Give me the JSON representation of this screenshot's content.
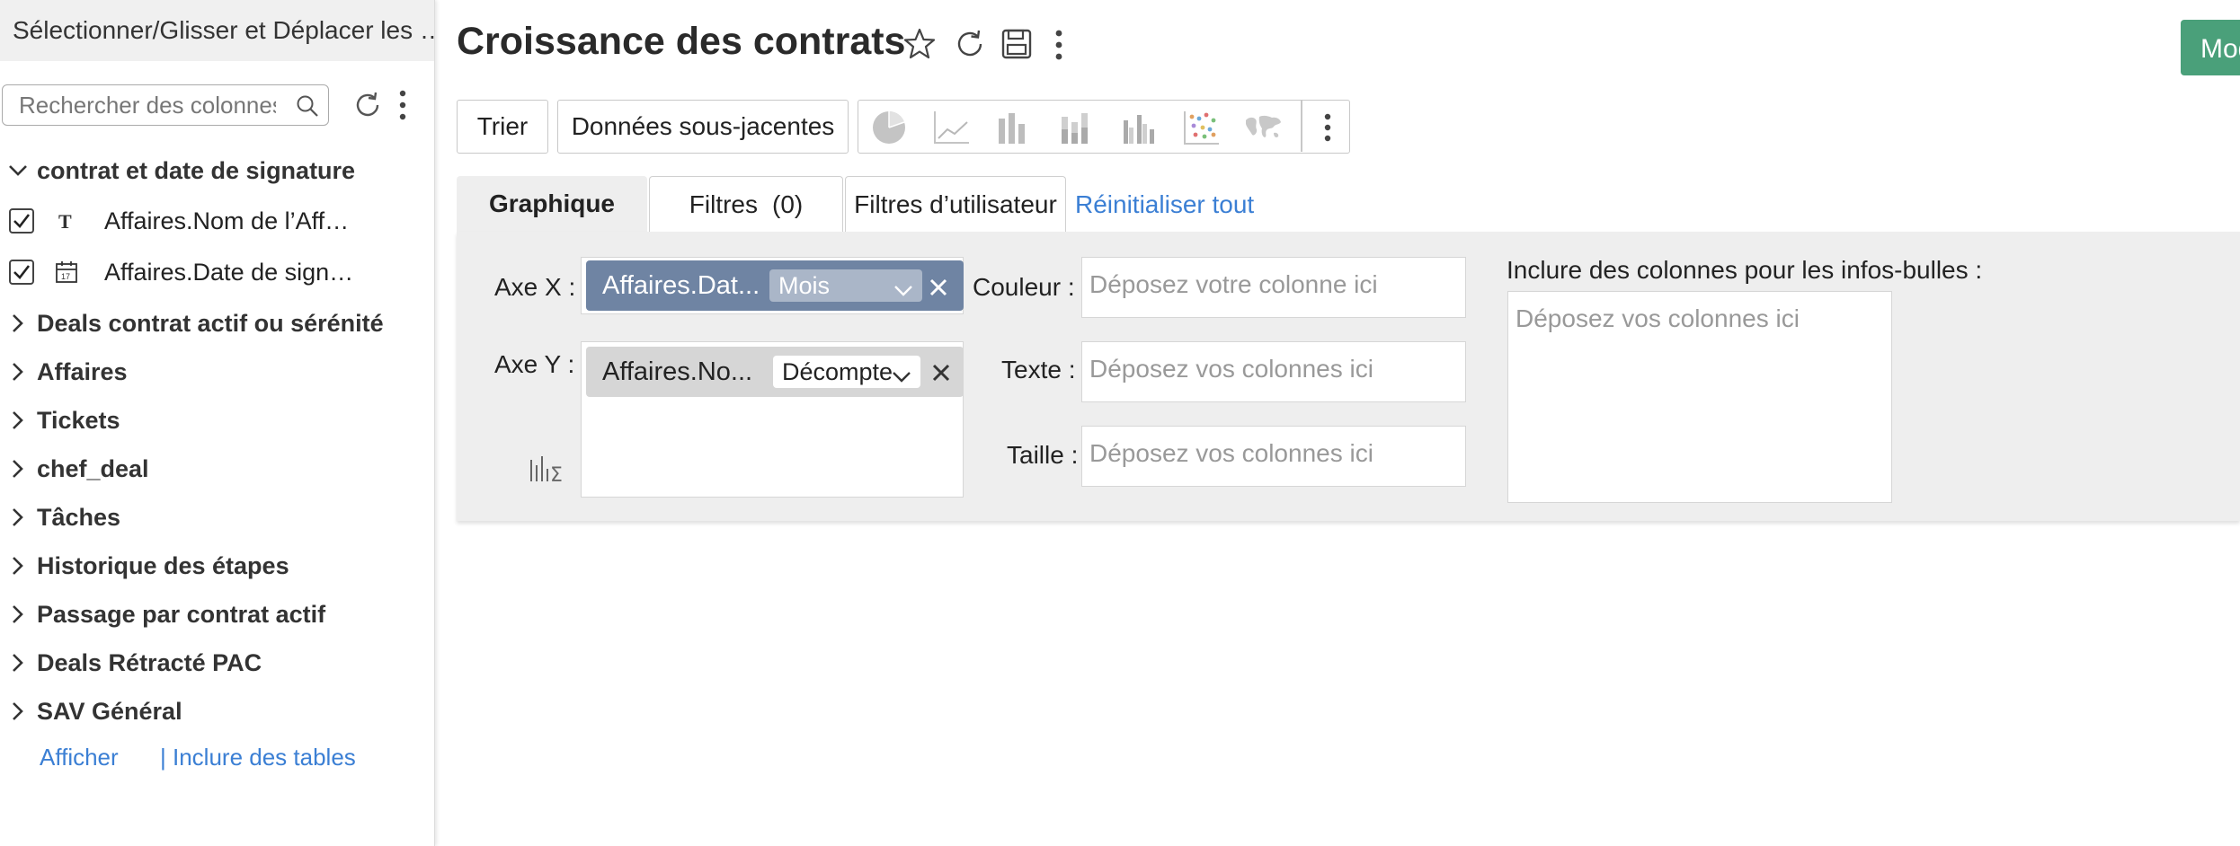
{
  "sidebar": {
    "header": "Sélectionner/Glisser et Déplacer les …",
    "search_placeholder": "Rechercher des colonnes",
    "group_expanded": "contrat et date de signature",
    "columns": [
      {
        "label": "Affaires.Nom de l’Aff…",
        "type_icon": "text-type-icon",
        "checked": true
      },
      {
        "label": "Affaires.Date de sign…",
        "type_icon": "calendar-icon",
        "checked": true
      }
    ],
    "tables": [
      "Deals contrat actif ou sérénité",
      "Affaires",
      "Tickets",
      "chef_deal",
      "Tâches",
      "Historique des étapes",
      "Passage par contrat actif",
      "Deals Rétracté PAC",
      "SAV Général"
    ],
    "link_show": "Afficher",
    "link_separator": "|",
    "link_include": "Inclure des tables"
  },
  "header": {
    "title": "Croissance des contrats",
    "mode_button": "Mode"
  },
  "toolbar": {
    "sort": "Trier",
    "underlying": "Données sous-jacentes",
    "chart_icons": [
      "pie-chart-icon",
      "line-chart-icon",
      "bar-chart-icon",
      "stacked-bar-chart-icon",
      "grouped-bar-chart-icon",
      "scatter-chart-icon",
      "map-chart-icon"
    ]
  },
  "tabs": {
    "graph": "Graphique",
    "filters": "Filtres",
    "filters_count": "(0)",
    "user_filters": "Filtres d’utilisateur",
    "reset": "Réinitialiser tout"
  },
  "panel": {
    "x_label": "Axe X :",
    "x_pill": "Affaires.Dat...",
    "x_agg": "Mois",
    "y_label": "Axe Y :",
    "y_pill": "Affaires.No...",
    "y_agg": "Décompte",
    "color_label": "Couleur :",
    "color_placeholder": "Déposez votre colonne ici",
    "text_label": "Texte :",
    "text_placeholder": "Déposez vos colonnes ici",
    "size_label": "Taille :",
    "size_placeholder": "Déposez vos colonnes ici",
    "tooltip_label": "Inclure des colonnes pour les infos-bulles :",
    "tooltip_placeholder": "Déposez vos colonnes ici"
  },
  "colors": {
    "accent_link": "#3b7fd4",
    "mode_button": "#4aa07a",
    "x_pill": "#6f84a3",
    "y_pill": "#d6d6d6"
  }
}
